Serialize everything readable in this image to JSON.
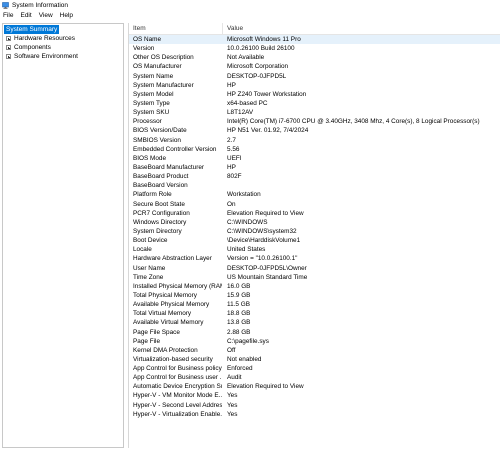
{
  "window": {
    "title": "System Information"
  },
  "menu": [
    "File",
    "Edit",
    "View",
    "Help"
  ],
  "tree": {
    "root": "System Summary",
    "children": [
      "Hardware Resources",
      "Components",
      "Software Environment"
    ]
  },
  "table": {
    "headers": {
      "item": "Item",
      "value": "Value"
    },
    "rows": [
      {
        "item": "OS Name",
        "value": "Microsoft Windows 11 Pro"
      },
      {
        "item": "Version",
        "value": "10.0.26100 Build 26100"
      },
      {
        "item": "Other OS Description",
        "value": "Not Available"
      },
      {
        "item": "OS Manufacturer",
        "value": "Microsoft Corporation"
      },
      {
        "item": "System Name",
        "value": "DESKTOP-0JFPD5L"
      },
      {
        "item": "System Manufacturer",
        "value": "HP"
      },
      {
        "item": "System Model",
        "value": "HP Z240 Tower Workstation"
      },
      {
        "item": "System Type",
        "value": "x64-based PC"
      },
      {
        "item": "System SKU",
        "value": "L8T12AV"
      },
      {
        "item": "Processor",
        "value": "Intel(R) Core(TM) i7-6700 CPU @ 3.40GHz, 3408 Mhz, 4 Core(s), 8 Logical Processor(s)"
      },
      {
        "item": "BIOS Version/Date",
        "value": "HP N51 Ver. 01.92, 7/4/2024"
      },
      {
        "item": "SMBIOS Version",
        "value": "2.7"
      },
      {
        "item": "Embedded Controller Version",
        "value": "5.56"
      },
      {
        "item": "BIOS Mode",
        "value": "UEFI"
      },
      {
        "item": "BaseBoard Manufacturer",
        "value": "HP"
      },
      {
        "item": "BaseBoard Product",
        "value": "802F"
      },
      {
        "item": "BaseBoard Version",
        "value": ""
      },
      {
        "item": "Platform Role",
        "value": "Workstation"
      },
      {
        "item": "Secure Boot State",
        "value": "On"
      },
      {
        "item": "PCR7 Configuration",
        "value": "Elevation Required to View"
      },
      {
        "item": "Windows Directory",
        "value": "C:\\WINDOWS"
      },
      {
        "item": "System Directory",
        "value": "C:\\WINDOWS\\system32"
      },
      {
        "item": "Boot Device",
        "value": "\\Device\\HarddiskVolume1"
      },
      {
        "item": "Locale",
        "value": "United States"
      },
      {
        "item": "Hardware Abstraction Layer",
        "value": "Version = \"10.0.26100.1\""
      },
      {
        "item": "User Name",
        "value": "DESKTOP-0JFPD5L\\Owner"
      },
      {
        "item": "Time Zone",
        "value": "US Mountain Standard Time"
      },
      {
        "item": "Installed Physical Memory (RAM)",
        "value": "16.0 GB"
      },
      {
        "item": "Total Physical Memory",
        "value": "15.9 GB"
      },
      {
        "item": "Available Physical Memory",
        "value": "11.5 GB"
      },
      {
        "item": "Total Virtual Memory",
        "value": "18.8 GB"
      },
      {
        "item": "Available Virtual Memory",
        "value": "13.8 GB"
      },
      {
        "item": "Page File Space",
        "value": "2.88 GB"
      },
      {
        "item": "Page File",
        "value": "C:\\pagefile.sys"
      },
      {
        "item": "Kernel DMA Protection",
        "value": "Off"
      },
      {
        "item": "Virtualization-based security",
        "value": "Not enabled"
      },
      {
        "item": "App Control for Business policy",
        "value": "Enforced"
      },
      {
        "item": "App Control for Business user ...",
        "value": "Audit"
      },
      {
        "item": "Automatic Device Encryption Su...",
        "value": "Elevation Required to View"
      },
      {
        "item": "Hyper-V - VM Monitor Mode E...",
        "value": "Yes"
      },
      {
        "item": "Hyper-V - Second Level Addres...",
        "value": "Yes"
      },
      {
        "item": "Hyper-V - Virtualization Enable...",
        "value": "Yes"
      }
    ]
  },
  "colors": {
    "selection": "#0078d7",
    "row_highlight": "#e5f1fb"
  },
  "icons": {
    "app": "system-information-icon",
    "expander": "plus-expander-icon"
  }
}
